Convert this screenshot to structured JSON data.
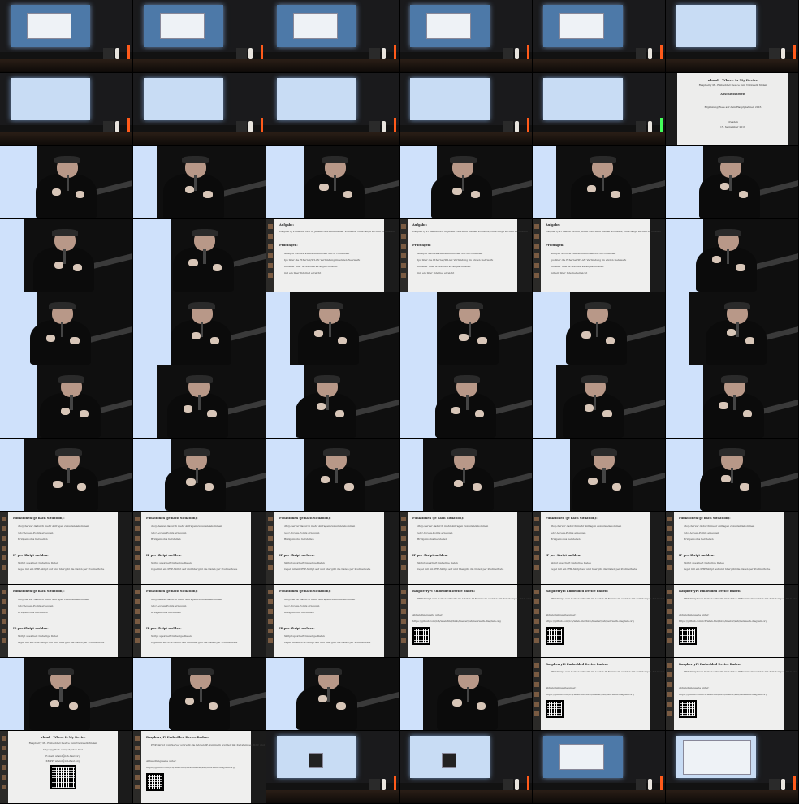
{
  "sheet": {
    "columns": 6,
    "rows": 11
  },
  "title_slide": {
    "title": "wland - Where Is My Device",
    "subtitle": "Raspberry Pi - Embedded Device zum Netzwerk finden",
    "heading": "Abschlussarbeit",
    "line": "Ergänzung/Ziele auf dem Hauptplatinen 2016",
    "date": "Dresden",
    "date2": "15. September 2016"
  },
  "aufgabe_slide": {
    "title": "Aufgabe:",
    "text": "Raspberry Pi meldet sich in jedem Netzwerk meiner Kontexte, ohne lange suchen zu müssen",
    "section": "Prüfungen:",
    "items": [
      "Analyse Netzwerkumfeldmethoden durch vorhanden",
      "Ips über die Ethernet/WLAN Verbindung im ersten Netzwerk",
      "Installer über IP-Netzwerke angeschlossen",
      "mit ein über Internet erreicht"
    ]
  },
  "funktionen_slide": {
    "title": "Funktionen (je nach Situation):",
    "items": [
      "dhcp-Server dadurch mehr Anfragen zuzustandekommen",
      "/etc/.Access-Points erzeugen",
      "Bridgemodus herstellen"
    ],
    "section": "IP per Skript melden:",
    "items2": [
      "Skript speichert bisherige Daten",
      "regel mit ein PHP-Skript auf und übergibt die Daten per Postmethode"
    ]
  },
  "rpi_slide": {
    "title": "RaspberryPi Embedded Device finden:",
    "items": [
      "PHP-Skript vom Server schreibt die letzten IP-Nummern wurden mit Zeitstempel, MAC und Hostname angezeigt"
    ],
    "label": "Abhandlungsseite unter:",
    "url": "https://github.com/ich/wlan-find/blob/master/ssh/netzwerk-diagram.org"
  },
  "end_slide": {
    "title": "wland - Where Is My Device",
    "subtitle": "Raspberry Pi - Embedded Device zum Netzwerk finden",
    "url": "https://github.com/ich/wlan-find",
    "contact1": "E-mail: wland@ich-flaut.org",
    "contact2": "XMPP: wland@ich-flaut.org"
  },
  "cells": [
    [
      "stage-desk",
      "stage-desk",
      "stage-desk",
      "stage-desk",
      "stage-desk",
      "stage-title"
    ],
    [
      "stage-title",
      "stage-title",
      "stage-title",
      "stage-title",
      "stage-title-green",
      "title"
    ],
    [
      "close",
      "close",
      "close",
      "close",
      "close",
      "close"
    ],
    [
      "close",
      "close",
      "aufgabe",
      "aufgabe",
      "aufgabe",
      "close"
    ],
    [
      "close",
      "close",
      "close",
      "close",
      "close",
      "close"
    ],
    [
      "close",
      "close",
      "close",
      "close",
      "close",
      "close"
    ],
    [
      "close",
      "close",
      "close",
      "close",
      "close",
      "close"
    ],
    [
      "funktionen",
      "funktionen",
      "funktionen",
      "funktionen",
      "funktionen",
      "funktionen"
    ],
    [
      "funktionen",
      "funktionen",
      "funktionen",
      "rpi",
      "rpi",
      "rpi"
    ],
    [
      "close",
      "close",
      "close",
      "close",
      "rpi",
      "rpi"
    ],
    [
      "end",
      "rpi",
      "stage-qr",
      "stage-qr",
      "stage-win",
      "stage-browser"
    ]
  ]
}
